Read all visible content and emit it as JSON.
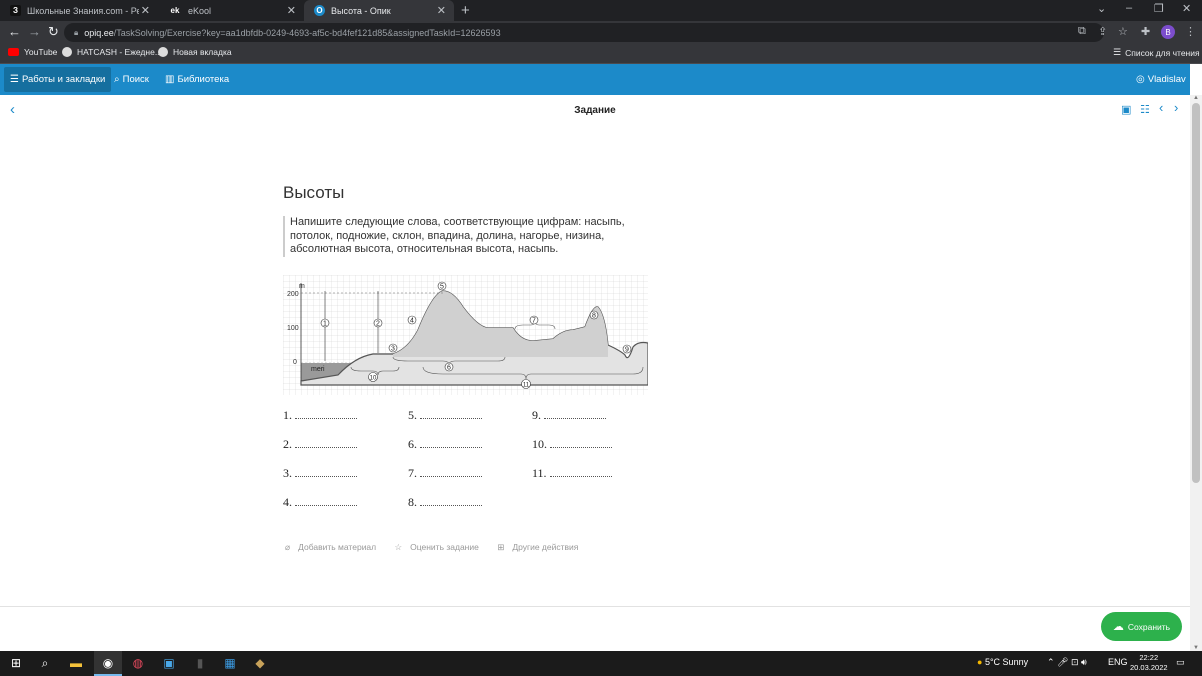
{
  "browser": {
    "tabs": [
      {
        "title": "Школьные Знания.com - Решае",
        "active": false,
        "favicon": "З"
      },
      {
        "title": "eKool",
        "active": false,
        "favicon": "ek"
      },
      {
        "title": "Высота - Опик",
        "active": true,
        "favicon": "O"
      }
    ],
    "url_host": "opiq.ee",
    "url_path": "/TaskSolving/Exercise?key=aa1dbfdb-0249-4693-af5c-bd4fef121d85&assignedTaskId=12626593",
    "profile_initial": "B",
    "bookmarks": [
      {
        "label": "YouTube",
        "color": "#ff0000"
      },
      {
        "label": "HATCASH - Ежедне...",
        "color": "#dddddd"
      },
      {
        "label": "Новая вкладка",
        "color": "#dddddd"
      }
    ],
    "reading_list": "Список для чтения"
  },
  "header": {
    "works": "Работы и закладки",
    "search": "Поиск",
    "library": "Библиотека",
    "user": "Vladislav"
  },
  "page": {
    "title": "Задание"
  },
  "exercise": {
    "title": "Высоты",
    "instruction": "Напишите следующие слова, соответствующие цифрам: насыпь, потолок, подножие, склон, впадина, долина, нагорье, низина, абсолютная высота, относительная высота, насыпь.",
    "diagram": {
      "axis_unit": "m",
      "ticks": [
        "200",
        "100",
        "0"
      ],
      "sea_label": "meri",
      "markers": [
        "1",
        "2",
        "3",
        "4",
        "5",
        "6",
        "7",
        "8",
        "9",
        "10",
        "11"
      ]
    },
    "answers": [
      "1.",
      "2.",
      "3.",
      "4.",
      "5.",
      "6.",
      "7.",
      "8.",
      "9.",
      "10.",
      "11."
    ]
  },
  "actions": {
    "add": "Добавить материал",
    "rate": "Оценить задание",
    "other": "Другие действия"
  },
  "save_label": "Сохранить",
  "taskbar": {
    "weather": "5°C  Sunny",
    "lang": "ENG",
    "time": "22:22",
    "date": "20.03.2022"
  }
}
